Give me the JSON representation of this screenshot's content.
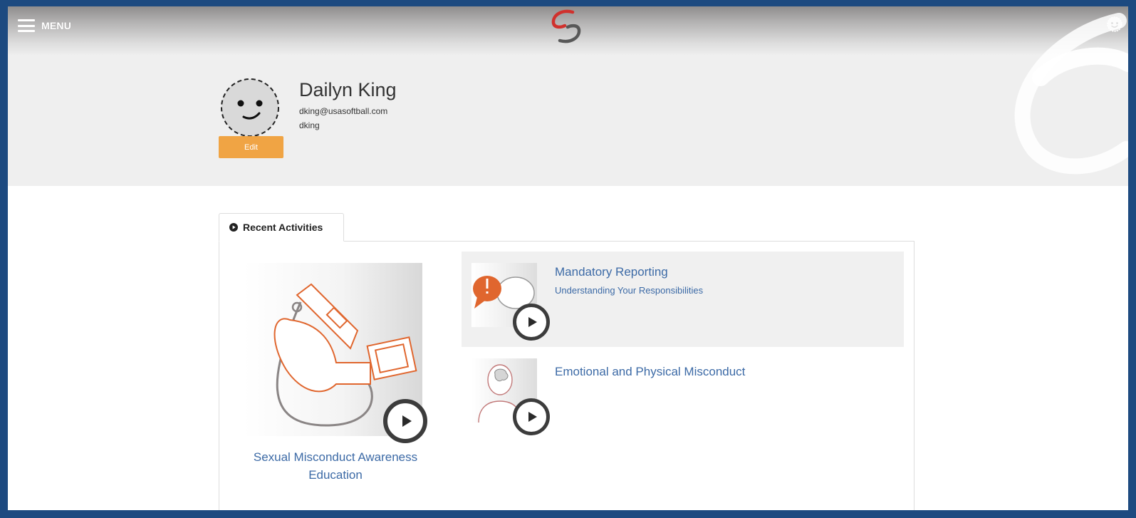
{
  "header": {
    "menu_label": "MENU",
    "logo_icon": "swirl-logo-icon",
    "user_icon": "smiley-avatar-icon"
  },
  "profile": {
    "name": "Dailyn King",
    "email": "dking@usasoftball.com",
    "username": "dking",
    "edit_label": "Edit"
  },
  "tabs": [
    {
      "label": "Recent Activities",
      "icon": "play-circle-icon",
      "active": true
    }
  ],
  "activities": {
    "featured": {
      "title": "Sexual Misconduct Awareness Education",
      "thumb_icon": "whistle-icon"
    },
    "items": [
      {
        "title": "Mandatory Reporting",
        "subtitle": "Understanding Your Responsibilities",
        "thumb_icon": "speech-bubble-icon"
      },
      {
        "title": "Emotional and Physical Misconduct",
        "subtitle": "",
        "thumb_icon": "person-brain-icon"
      }
    ]
  },
  "colors": {
    "frame": "#1d4a80",
    "accent_orange": "#f0a444",
    "link_blue": "#3c6aa6",
    "logo_red": "#d0312d",
    "whistle_orange": "#e0662e"
  }
}
